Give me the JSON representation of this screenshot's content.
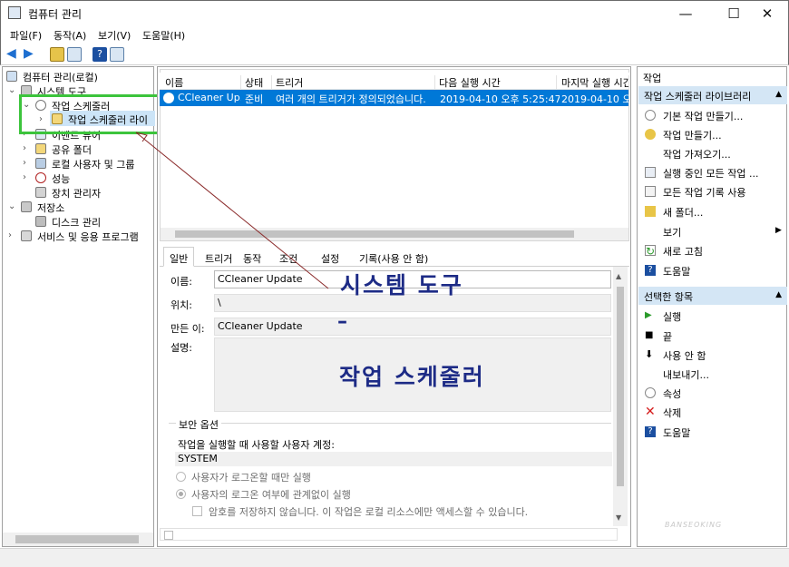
{
  "window": {
    "title": "컴퓨터 관리",
    "minimize": "—",
    "maximize": "☐",
    "close": "✕"
  },
  "menu": [
    "파일(F)",
    "동작(A)",
    "보기(V)",
    "도움말(H)"
  ],
  "tree": {
    "root": "컴퓨터 관리(로컬)",
    "system_tools": "시스템 도구",
    "task_scheduler": "작업 스케줄러",
    "task_library": "작업 스케줄러 라이",
    "event_viewer": "이벤트 뷰어",
    "shared_folders": "공유 폴더",
    "local_users": "로컬 사용자 및 그룹",
    "performance": "성능",
    "device_manager": "장치 관리자",
    "storage": "저장소",
    "disk_mgmt": "디스크 관리",
    "services_apps": "서비스 및 응용 프로그램"
  },
  "task_list": {
    "columns": [
      "이름",
      "상태",
      "트리거",
      "다음 실행 시간",
      "마지막 실행 시간"
    ],
    "rows": [
      {
        "name": "CCleaner Up...",
        "status": "준비",
        "trigger": "여러 개의 트리거가 정의되었습니다.",
        "next_run": "2019-04-10 오후 5:25:47",
        "last_run": "2019-04-10 오후"
      }
    ]
  },
  "tabs": [
    "일반",
    "트리거",
    "동작",
    "조건",
    "설정",
    "기록(사용 안 함)"
  ],
  "general": {
    "name_label": "이름:",
    "name_value": "CCleaner Update",
    "location_label": "위치:",
    "location_value": "\\",
    "author_label": "만든 이:",
    "author_value": "CCleaner Update",
    "desc_label": "설명:",
    "security_title": "보안 옵션",
    "account_label": "작업을 실행할 때 사용할 사용자 계정:",
    "account_value": "SYSTEM",
    "radio1": "사용자가 로그온할 때만 실행",
    "radio2": "사용자의 로그온 여부에 관계없이 실행",
    "checkbox1": "암호를 저장하지 않습니다. 이 작업은 로컬 리소스에만 액세스할 수 있습니다."
  },
  "actions": {
    "header": "작업",
    "section1": "작업 스케줄러 라이브러리",
    "items1": [
      "기본 작업 만들기...",
      "작업 만들기...",
      "작업 가져오기...",
      "실행 중인 모든 작업 ...",
      "모든 작업 기록 사용",
      "새 폴더...",
      "보기",
      "새로 고침",
      "도움말"
    ],
    "section2": "선택한 항목",
    "items2": [
      "실행",
      "끝",
      "사용 안 함",
      "내보내기...",
      "속성",
      "삭제",
      "도움말"
    ]
  },
  "annotations": {
    "system_tools": "시스템 도구",
    "dash": "–",
    "task_scheduler": "작업 스케줄러"
  },
  "watermark": "BANSEOKING"
}
